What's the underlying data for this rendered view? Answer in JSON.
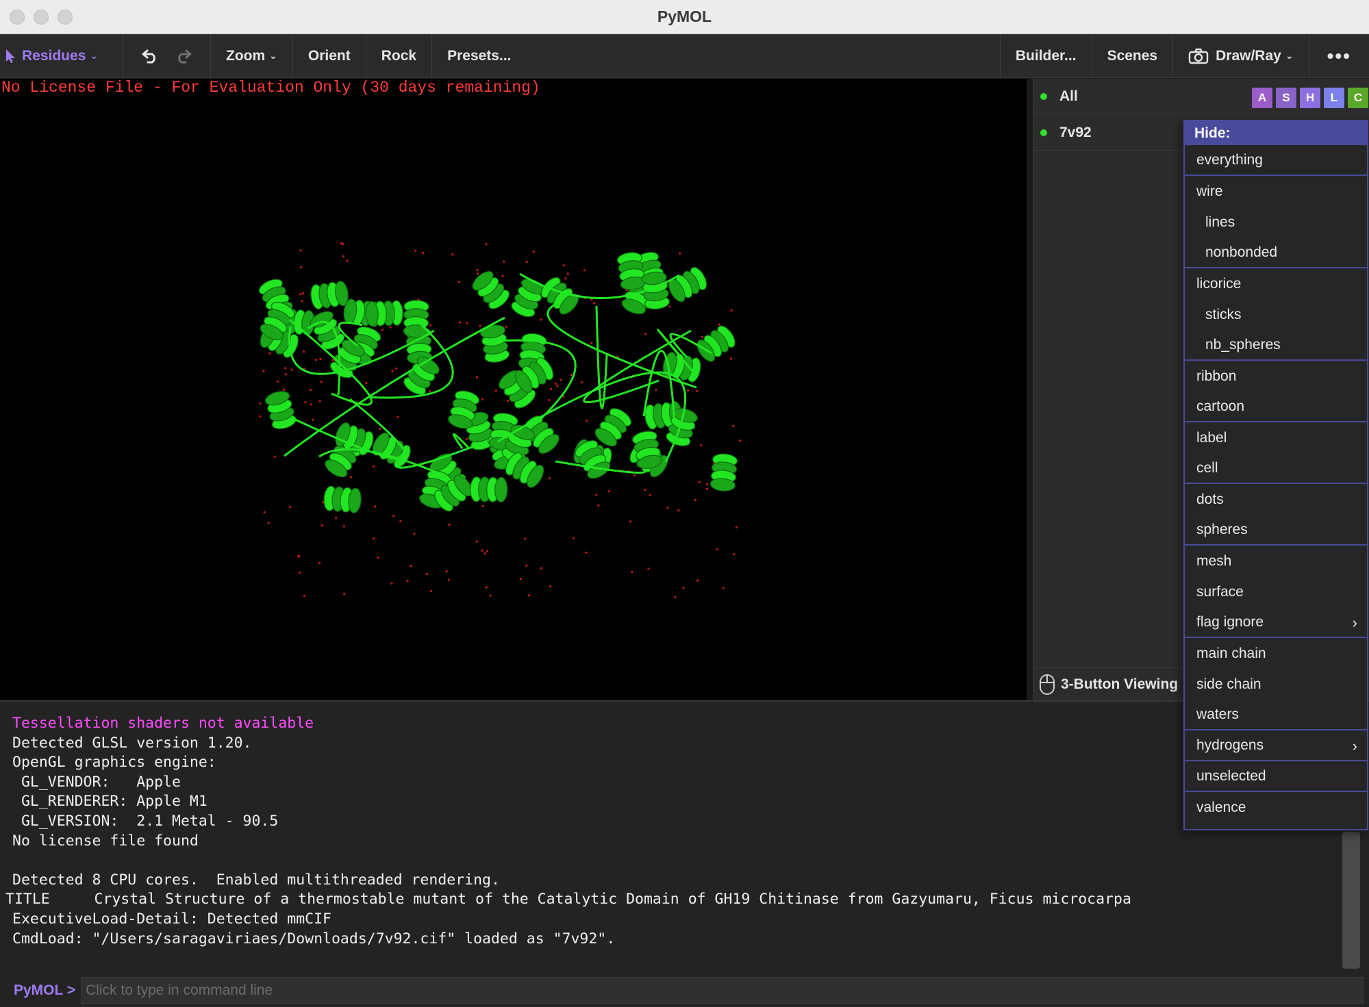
{
  "window": {
    "title": "PyMOL"
  },
  "toolbar": {
    "mode_label": "Residues",
    "zoom_label": "Zoom",
    "orient_label": "Orient",
    "rock_label": "Rock",
    "presets_label": "Presets...",
    "builder_label": "Builder...",
    "scenes_label": "Scenes",
    "drawray_label": "Draw/Ray",
    "more_label": "•••"
  },
  "viewport": {
    "license_text": "No License File - For Evaluation Only (30 days remaining)",
    "molecule_color": "#22e622"
  },
  "objects_panel": {
    "objects": [
      {
        "name": "All"
      },
      {
        "name": "7v92"
      }
    ],
    "ashlc": [
      {
        "label": "A",
        "color": "#9c5cc9"
      },
      {
        "label": "S",
        "color": "#8a63c7"
      },
      {
        "label": "H",
        "color": "#8d6fe0"
      },
      {
        "label": "L",
        "color": "#7b82e8"
      },
      {
        "label": "C",
        "color": "#5aa829"
      }
    ],
    "mouse_mode_label": "3-Button Viewing"
  },
  "hide_menu": {
    "header": "Hide:",
    "items": [
      {
        "label": "everything",
        "sub": false,
        "sep": true,
        "arrow": false
      },
      {
        "label": "wire",
        "sub": false,
        "sep": false,
        "arrow": false
      },
      {
        "label": "lines",
        "sub": true,
        "sep": false,
        "arrow": false
      },
      {
        "label": "nonbonded",
        "sub": true,
        "sep": true,
        "arrow": false
      },
      {
        "label": "licorice",
        "sub": false,
        "sep": false,
        "arrow": false
      },
      {
        "label": "sticks",
        "sub": true,
        "sep": false,
        "arrow": false
      },
      {
        "label": "nb_spheres",
        "sub": true,
        "sep": true,
        "arrow": false
      },
      {
        "label": "ribbon",
        "sub": false,
        "sep": false,
        "arrow": false
      },
      {
        "label": "cartoon",
        "sub": false,
        "sep": true,
        "arrow": false
      },
      {
        "label": "label",
        "sub": false,
        "sep": false,
        "arrow": false
      },
      {
        "label": "cell",
        "sub": false,
        "sep": true,
        "arrow": false
      },
      {
        "label": "dots",
        "sub": false,
        "sep": false,
        "arrow": false
      },
      {
        "label": "spheres",
        "sub": false,
        "sep": true,
        "arrow": false
      },
      {
        "label": "mesh",
        "sub": false,
        "sep": false,
        "arrow": false
      },
      {
        "label": "surface",
        "sub": false,
        "sep": false,
        "arrow": false
      },
      {
        "label": "flag ignore",
        "sub": false,
        "sep": true,
        "arrow": true
      },
      {
        "label": "main chain",
        "sub": false,
        "sep": false,
        "arrow": false
      },
      {
        "label": "side chain",
        "sub": false,
        "sep": false,
        "arrow": false
      },
      {
        "label": "waters",
        "sub": false,
        "sep": true,
        "arrow": false
      },
      {
        "label": "hydrogens",
        "sub": false,
        "sep": true,
        "arrow": true
      },
      {
        "label": "unselected",
        "sub": false,
        "sep": true,
        "arrow": false
      },
      {
        "label": "valence",
        "sub": false,
        "sep": false,
        "arrow": false
      }
    ]
  },
  "console": {
    "lines": [
      {
        "text": "Tessellation shaders not available",
        "warn": true
      },
      {
        "text": "Detected GLSL version 1.20.",
        "warn": false
      },
      {
        "text": "OpenGL graphics engine:",
        "warn": false
      },
      {
        "text": " GL_VENDOR:   Apple",
        "warn": false
      },
      {
        "text": " GL_RENDERER: Apple M1",
        "warn": false
      },
      {
        "text": " GL_VERSION:  2.1 Metal - 90.5",
        "warn": false
      },
      {
        "text": "No license file found",
        "warn": false
      },
      {
        "text": "",
        "warn": false
      },
      {
        "text": "Detected 8 CPU cores.  Enabled multithreaded rendering.",
        "warn": false
      },
      {
        "text": "TITLE     Crystal Structure of a thermostable mutant of the Catalytic Domain of GH19 Chitinase from Gazyumaru, Ficus microcarpa",
        "warn": false,
        "outdent": true
      },
      {
        "text": "ExecutiveLoad-Detail: Detected mmCIF",
        "warn": false
      },
      {
        "text": "CmdLoad: \"/Users/saragaviriaes/Downloads/7v92.cif\" loaded as \"7v92\".",
        "warn": false
      }
    ]
  },
  "command_line": {
    "prompt": "PyMOL >",
    "placeholder": "Click to type in command line",
    "value": ""
  }
}
